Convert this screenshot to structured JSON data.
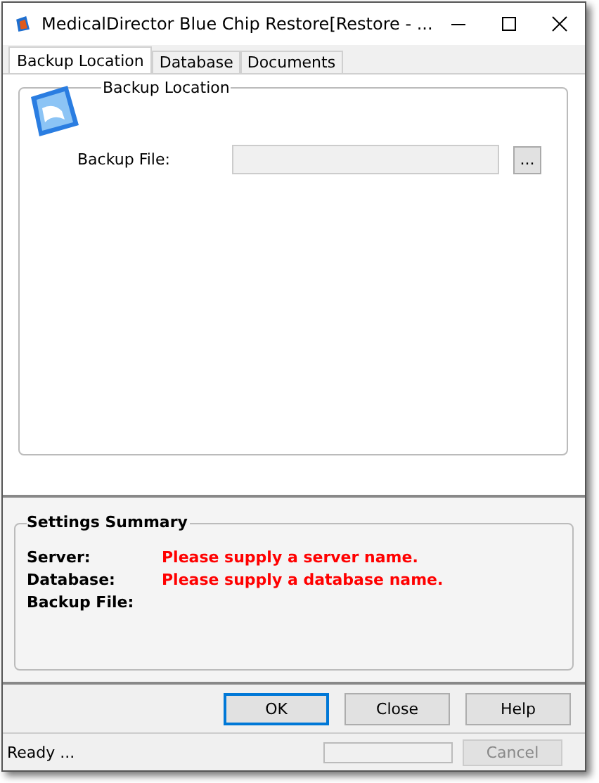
{
  "window": {
    "title": "MedicalDirector Blue Chip Restore[Restore - ..."
  },
  "tabs": [
    {
      "label": "Backup Location",
      "selected": true
    },
    {
      "label": "Database",
      "selected": false
    },
    {
      "label": "Documents",
      "selected": false
    }
  ],
  "backup_location": {
    "title": "Backup Location",
    "field_label": "Backup File:",
    "browse_button": "..."
  },
  "summary": {
    "title": "Settings Summary",
    "rows": [
      {
        "label": "Server:",
        "value": "Please supply a server name."
      },
      {
        "label": "Database:",
        "value": "Please supply a database name."
      },
      {
        "label": "Backup File:"
      }
    ]
  },
  "buttons": [
    {
      "label": "OK",
      "default": true
    },
    {
      "label": "Close",
      "default": false
    },
    {
      "label": "Help",
      "default": false
    }
  ],
  "status_bar": {
    "text": "Ready ...",
    "cancel": {
      "label": "Cancel",
      "disabled": true
    }
  }
}
